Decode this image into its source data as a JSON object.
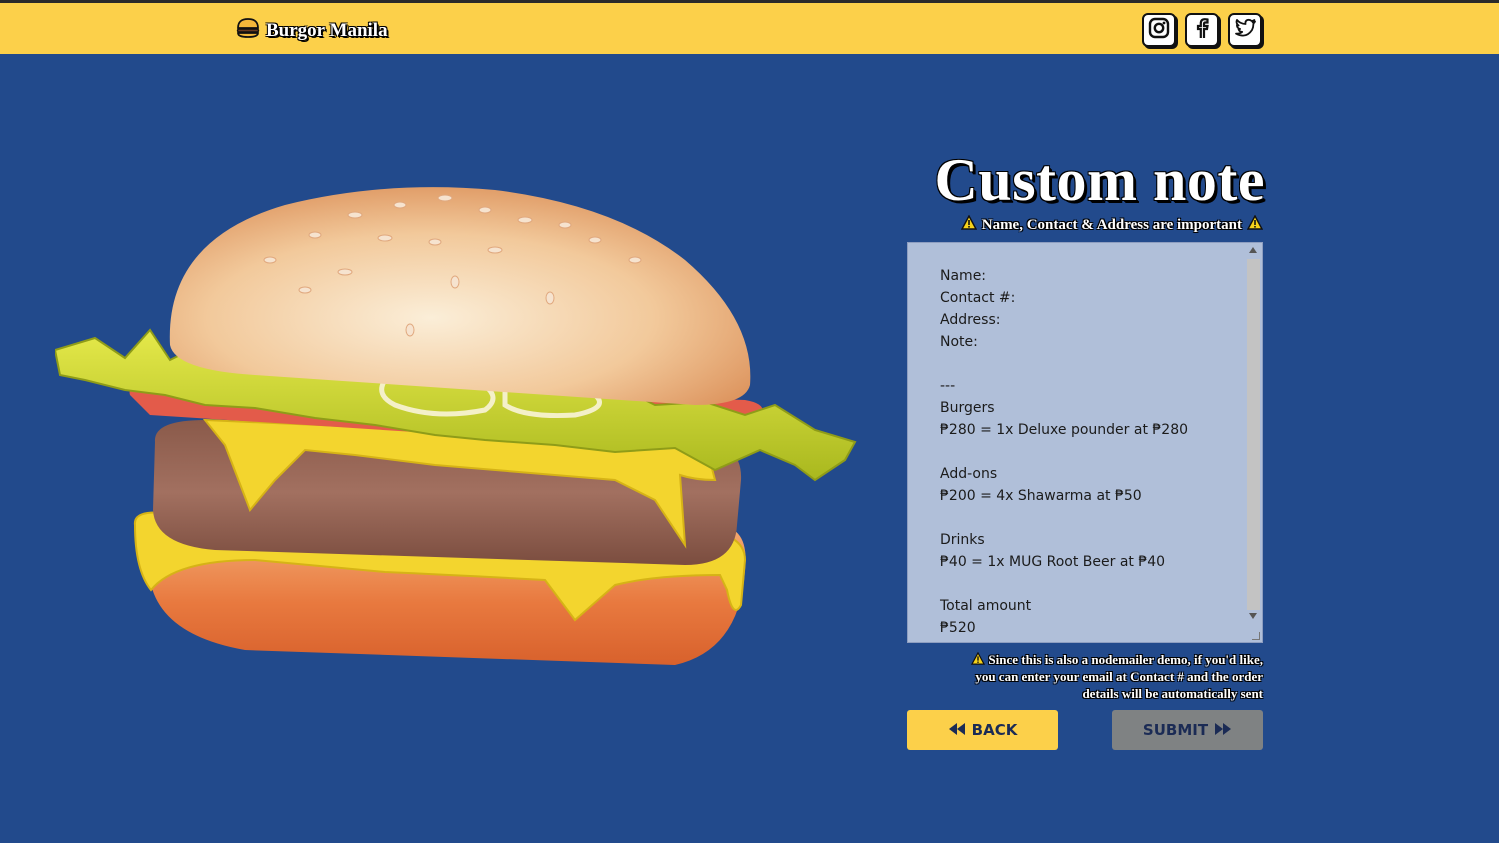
{
  "header": {
    "brand": "Burgor Manila",
    "socials": [
      "instagram-icon",
      "facebook-icon",
      "twitter-icon"
    ]
  },
  "main": {
    "title": "Custom note",
    "subtitle": "Name, Contact & Address are important",
    "note_lines": [
      "Name:",
      "Contact #:",
      "Address:",
      "Note:",
      "",
      "---",
      "Burgers",
      "₱280 = 1x Deluxe pounder at ₱280",
      "",
      "Add-ons",
      "₱200 = 4x Shawarma at ₱50",
      "",
      "Drinks",
      "₱40 = 1x MUG Root Beer at ₱40",
      "",
      "Total amount",
      "₱520"
    ],
    "info_lines": [
      "Since this is also a nodemailer demo, if you'd like,",
      "you can enter your email at Contact # and the order",
      "details will be automatically sent"
    ],
    "back_label": "BACK",
    "submit_label": "SUBMIT"
  },
  "colors": {
    "background": "#224a8c",
    "topbar": "#fcd04a",
    "back_button": "#fcd04a",
    "submit_button": "#7f8283",
    "note_bg": "#b0bfd9"
  }
}
